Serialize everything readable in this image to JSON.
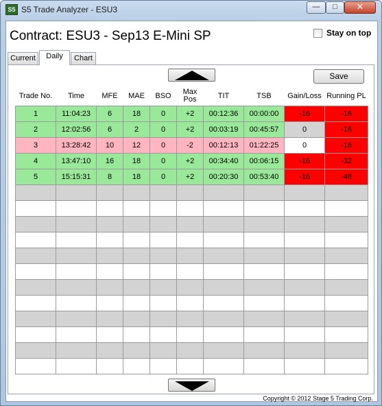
{
  "window": {
    "title": "S5 Trade Analyzer - ESU3",
    "icon_text": "S5",
    "minimize_glyph": "—",
    "maximize_glyph": "□",
    "close_glyph": "✕"
  },
  "header": {
    "contract_title": "Contract: ESU3 - Sep13 E-Mini SP",
    "stay_on_top_label": "Stay on top",
    "stay_on_top_checked": false
  },
  "tabs": [
    {
      "label": "Current",
      "active": false
    },
    {
      "label": "Daily",
      "active": true
    },
    {
      "label": "Chart",
      "active": false
    }
  ],
  "toolbar": {
    "save_label": "Save",
    "scroll_up_icon": "up-triangle",
    "scroll_down_icon": "down-triangle"
  },
  "table": {
    "headers": [
      "Trade No.",
      "Time",
      "MFE",
      "MAE",
      "BSO",
      "Max Pos",
      "TIT",
      "TSB",
      "Gain/Loss",
      "Running PL"
    ],
    "rows": [
      {
        "cells": [
          "1",
          "11:04:23",
          "6",
          "18",
          "0",
          "+2",
          "00:12:36",
          "00:00:00",
          "-16",
          "-16"
        ],
        "row_color": "#9ae89a",
        "gain_color": "#ff0000",
        "running_color": "#ff0000"
      },
      {
        "cells": [
          "2",
          "12:02:56",
          "6",
          "2",
          "0",
          "+2",
          "00:03:19",
          "00:45:57",
          "0",
          "-16"
        ],
        "row_color": "#9ae89a",
        "gain_color": "#d3d3d3",
        "running_color": "#ff0000"
      },
      {
        "cells": [
          "3",
          "13:28:42",
          "10",
          "12",
          "0",
          "-2",
          "00:12:13",
          "01:22:25",
          "0",
          "-16"
        ],
        "row_color": "#ffb6c1",
        "gain_color": "#ffffff",
        "running_color": "#ff0000"
      },
      {
        "cells": [
          "4",
          "13:47:10",
          "16",
          "18",
          "0",
          "+2",
          "00:34:40",
          "00:06:15",
          "-16",
          "-32"
        ],
        "row_color": "#9ae89a",
        "gain_color": "#ff0000",
        "running_color": "#ff0000"
      },
      {
        "cells": [
          "5",
          "15:15:31",
          "8",
          "18",
          "0",
          "+2",
          "00:20:30",
          "00:53:40",
          "-16",
          "-48"
        ],
        "row_color": "#9ae89a",
        "gain_color": "#ff0000",
        "running_color": "#ff0000"
      }
    ],
    "empty_rows": 12
  },
  "footer": {
    "copyright": "Copyright © 2012 Stage 5 Trading Corp."
  }
}
